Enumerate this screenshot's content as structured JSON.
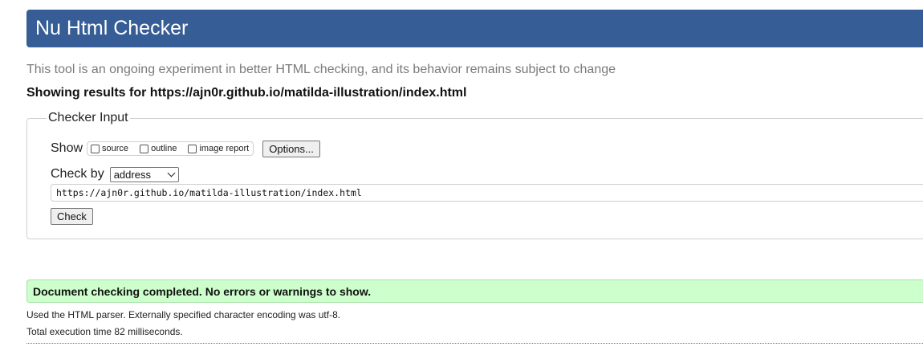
{
  "header": {
    "title": "Nu Html Checker",
    "bar_color": "#365d95"
  },
  "tagline": "This tool is an ongoing experiment in better HTML checking, and its behavior remains subject to change",
  "showing_results": "Showing results for https://ajn0r.github.io/matilda-illustration/index.html",
  "checker_input": {
    "legend": "Checker Input",
    "show": {
      "label": "Show",
      "options": [
        {
          "label": "source",
          "checked": false
        },
        {
          "label": "outline",
          "checked": false
        },
        {
          "label": "image report",
          "checked": false
        }
      ],
      "options_button": "Options..."
    },
    "check_by": {
      "label": "Check by",
      "selected": "address"
    },
    "url_value": "https://ajn0r.github.io/matilda-illustration/index.html",
    "check_button": "Check"
  },
  "result": {
    "message": "Document checking completed. No errors or warnings to show.",
    "color": "#ccffcc"
  },
  "notes": {
    "parser": "Used the HTML parser. Externally specified character encoding was utf-8.",
    "execution": "Total execution time 82 milliseconds."
  }
}
